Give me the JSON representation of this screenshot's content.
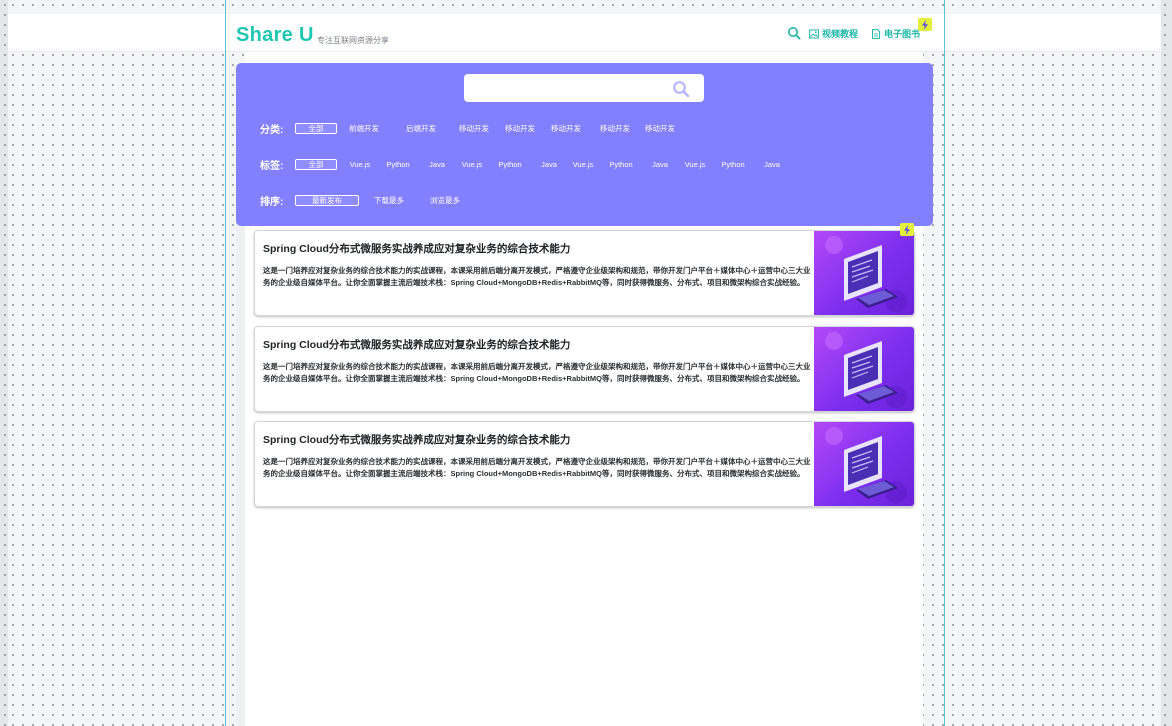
{
  "header": {
    "logo": "Share U",
    "tagline": "专注互联网资源分享",
    "nav": [
      {
        "label": "视频教程",
        "icon": "image-icon"
      },
      {
        "label": "电子图书",
        "icon": "document-icon"
      }
    ],
    "search_icon": "search-icon",
    "badge_icon": "lightning-icon"
  },
  "filters": {
    "search": {
      "value": "",
      "placeholder": ""
    },
    "category": {
      "label": "分类:",
      "options": [
        "全部",
        "前端开发",
        "后端开发",
        "移动开发",
        "移动开发",
        "移动开发",
        "移动开发",
        "移动开发"
      ],
      "active_index": 0
    },
    "tag": {
      "label": "标签:",
      "options": [
        "全部",
        "Vue.js",
        "Python",
        "Java",
        "Vue.js",
        "Python",
        "Java",
        "Vue.js",
        "Python",
        "Java",
        "Vue.js",
        "Python",
        "Java"
      ],
      "active_index": 0
    },
    "sort": {
      "label": "排序:",
      "options": [
        "最新发布",
        "下载最多",
        "浏览最多"
      ],
      "active_index": 0
    }
  },
  "courses": [
    {
      "title": "Spring Cloud分布式微服务实战养成应对复杂业务的综合技术能力",
      "description": "这是一门培养应对复杂业务的综合技术能力的实战课程，本课采用前后端分离开发模式，严格遵守企业级架构和规范，带你开发门户平台＋媒体中心＋运营中心三大业务的企业级自媒体平台。让你全面掌握主流后端技术栈：Spring Cloud+MongoDB+Redis+RabbitMQ等，同时获得微服务、分布式、项目和微架构综合实战经验。"
    },
    {
      "title": "Spring Cloud分布式微服务实战养成应对复杂业务的综合技术能力",
      "description": "这是一门培养应对复杂业务的综合技术能力的实战课程，本课采用前后端分离开发模式，严格遵守企业级架构和规范，带你开发门户平台＋媒体中心＋运营中心三大业务的企业级自媒体平台。让你全面掌握主流后端技术栈：Spring Cloud+MongoDB+Redis+RabbitMQ等，同时获得微服务、分布式、项目和微架构综合实战经验。"
    },
    {
      "title": "Spring Cloud分布式微服务实战养成应对复杂业务的综合技术能力",
      "description": "这是一门培养应对复杂业务的综合技术能力的实战课程，本课采用前后端分离开发模式，严格遵守企业级架构和规范，带你开发门户平台＋媒体中心＋运营中心三大业务的企业级自媒体平台。让你全面掌握主流后端技术栈：Spring Cloud+MongoDB+Redis+RabbitMQ等，同时获得微服务、分布式、项目和微架构综合实战经验。"
    }
  ],
  "colors": {
    "brand": "#1fc7b3",
    "panel": "#8280ff",
    "badge": "#e4ef3c",
    "thumb": "#8a35f0"
  }
}
